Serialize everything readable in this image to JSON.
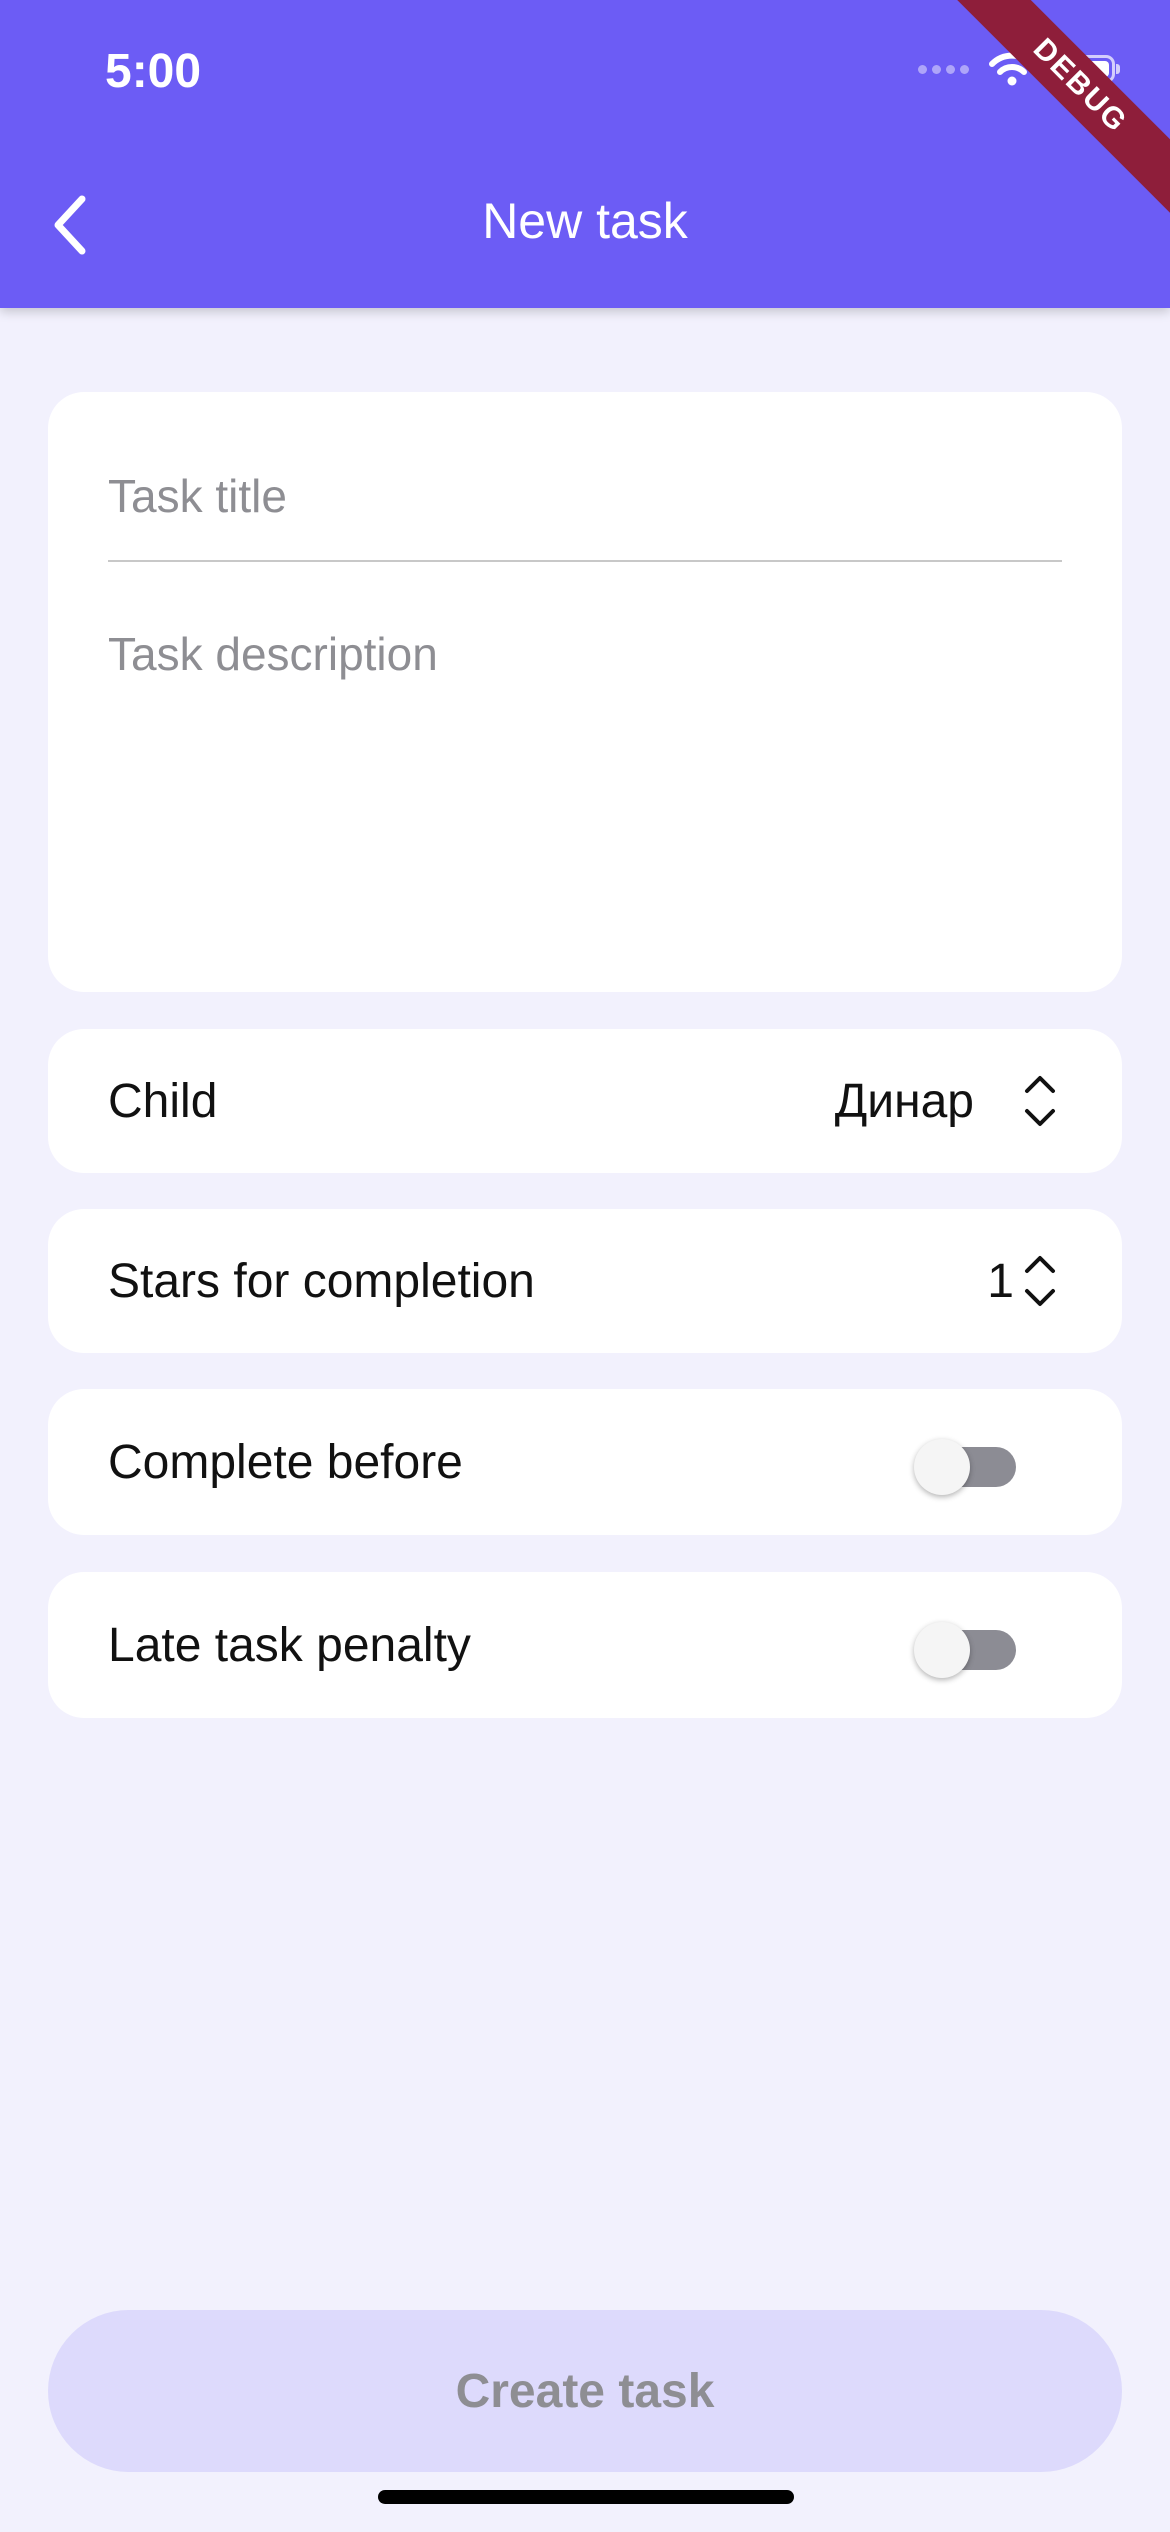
{
  "status_bar": {
    "time": "5:00"
  },
  "debug_banner": "DEBUG",
  "app_bar": {
    "title": "New task",
    "back_icon": "chevron-left-icon"
  },
  "form": {
    "title_placeholder": "Task title",
    "description_placeholder": "Task description"
  },
  "child_row": {
    "label": "Child",
    "value": "Динар",
    "icon": "chevron-up-down-icon"
  },
  "stars_row": {
    "label": "Stars for completion",
    "value": "1",
    "icon": "chevron-up-down-icon"
  },
  "complete_before_row": {
    "label": "Complete before",
    "enabled": false
  },
  "late_penalty_row": {
    "label": "Late task penalty",
    "enabled": false
  },
  "create_button": {
    "label": "Create task"
  },
  "colors": {
    "primary": "#6c5cf5",
    "background": "#f2f1fd",
    "button_disabled_bg": "#dddafc",
    "debug_banner": "#8e1e3a"
  }
}
